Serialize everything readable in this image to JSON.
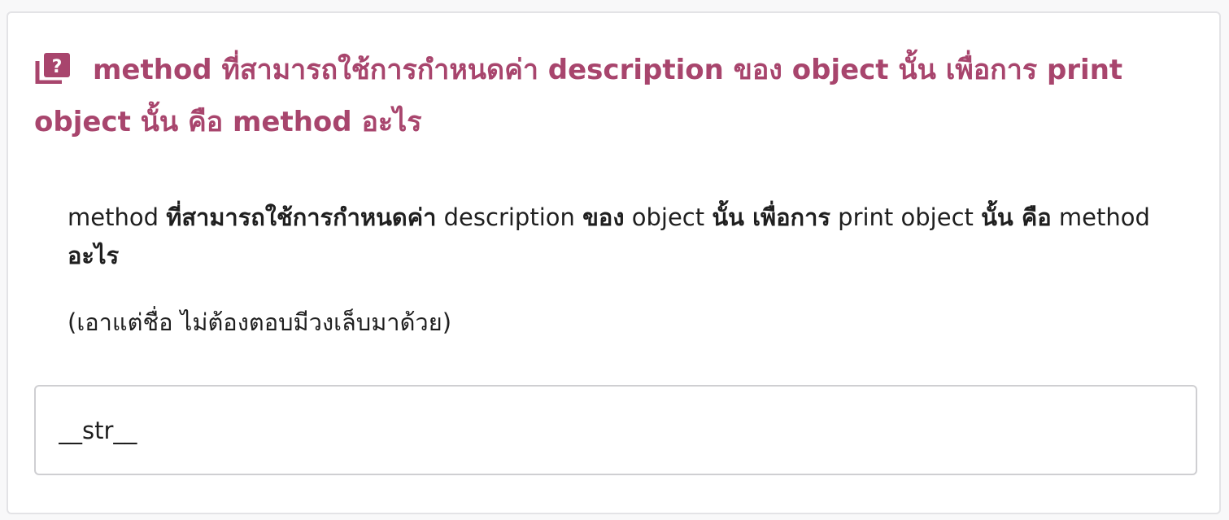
{
  "question": {
    "icon": "question-book-icon",
    "title": "method ที่สามารถใช้การกำหนดค่า description ของ object นั้น เพื่อการ print object นั้น คือ method อะไร"
  },
  "prompt": {
    "segments": [
      "method ",
      "ที่สามารถใช้การกำหนดค่า",
      " description ",
      "ของ",
      " object ",
      "นั้น เพื่อการ",
      " print object ",
      "นั้น คือ",
      " method ",
      "อะไร"
    ],
    "hint": "(เอาแต่ชื่อ ไม่ต้องตอบมีวงเล็บมาด้วย)"
  },
  "answer": {
    "value": "__str__"
  },
  "colors": {
    "accent": "#a8456d",
    "text": "#1f1f1f",
    "border": "#cfcfd2"
  }
}
